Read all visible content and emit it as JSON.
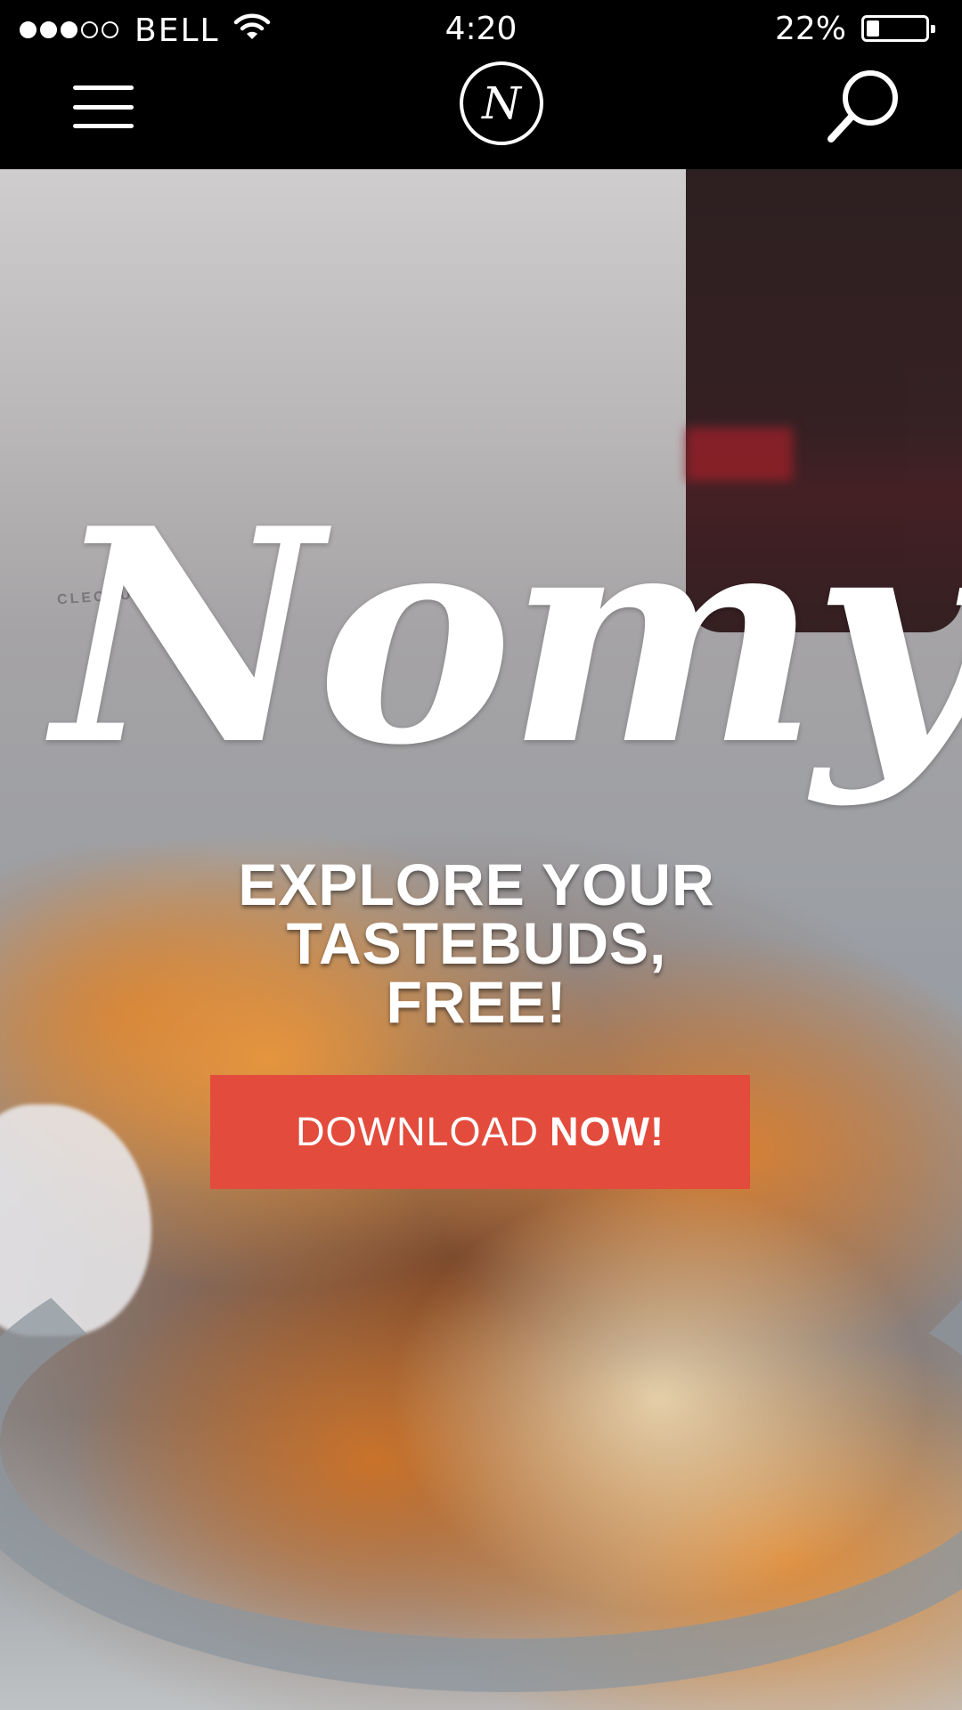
{
  "status_bar": {
    "carrier": "BELL",
    "time": "4:20",
    "battery_percent": "22%",
    "battery_level": 0.22,
    "signal_strength": 3,
    "signal_max": 5
  },
  "nav": {
    "menu_icon": "hamburger-menu-icon",
    "logo_letter": "N",
    "search_icon": "search-icon"
  },
  "hero": {
    "brand": "Nomy",
    "watermark": "CLEOBUTTERA",
    "tagline": [
      "EXPLORE YOUR",
      "TASTEBUDS,",
      "FREE!"
    ],
    "cta_light": "DOWNLOAD",
    "cta_strong": "NOW!"
  },
  "colors": {
    "cta_background": "#e34b3c",
    "bar_background": "#000000",
    "text": "#ffffff"
  }
}
